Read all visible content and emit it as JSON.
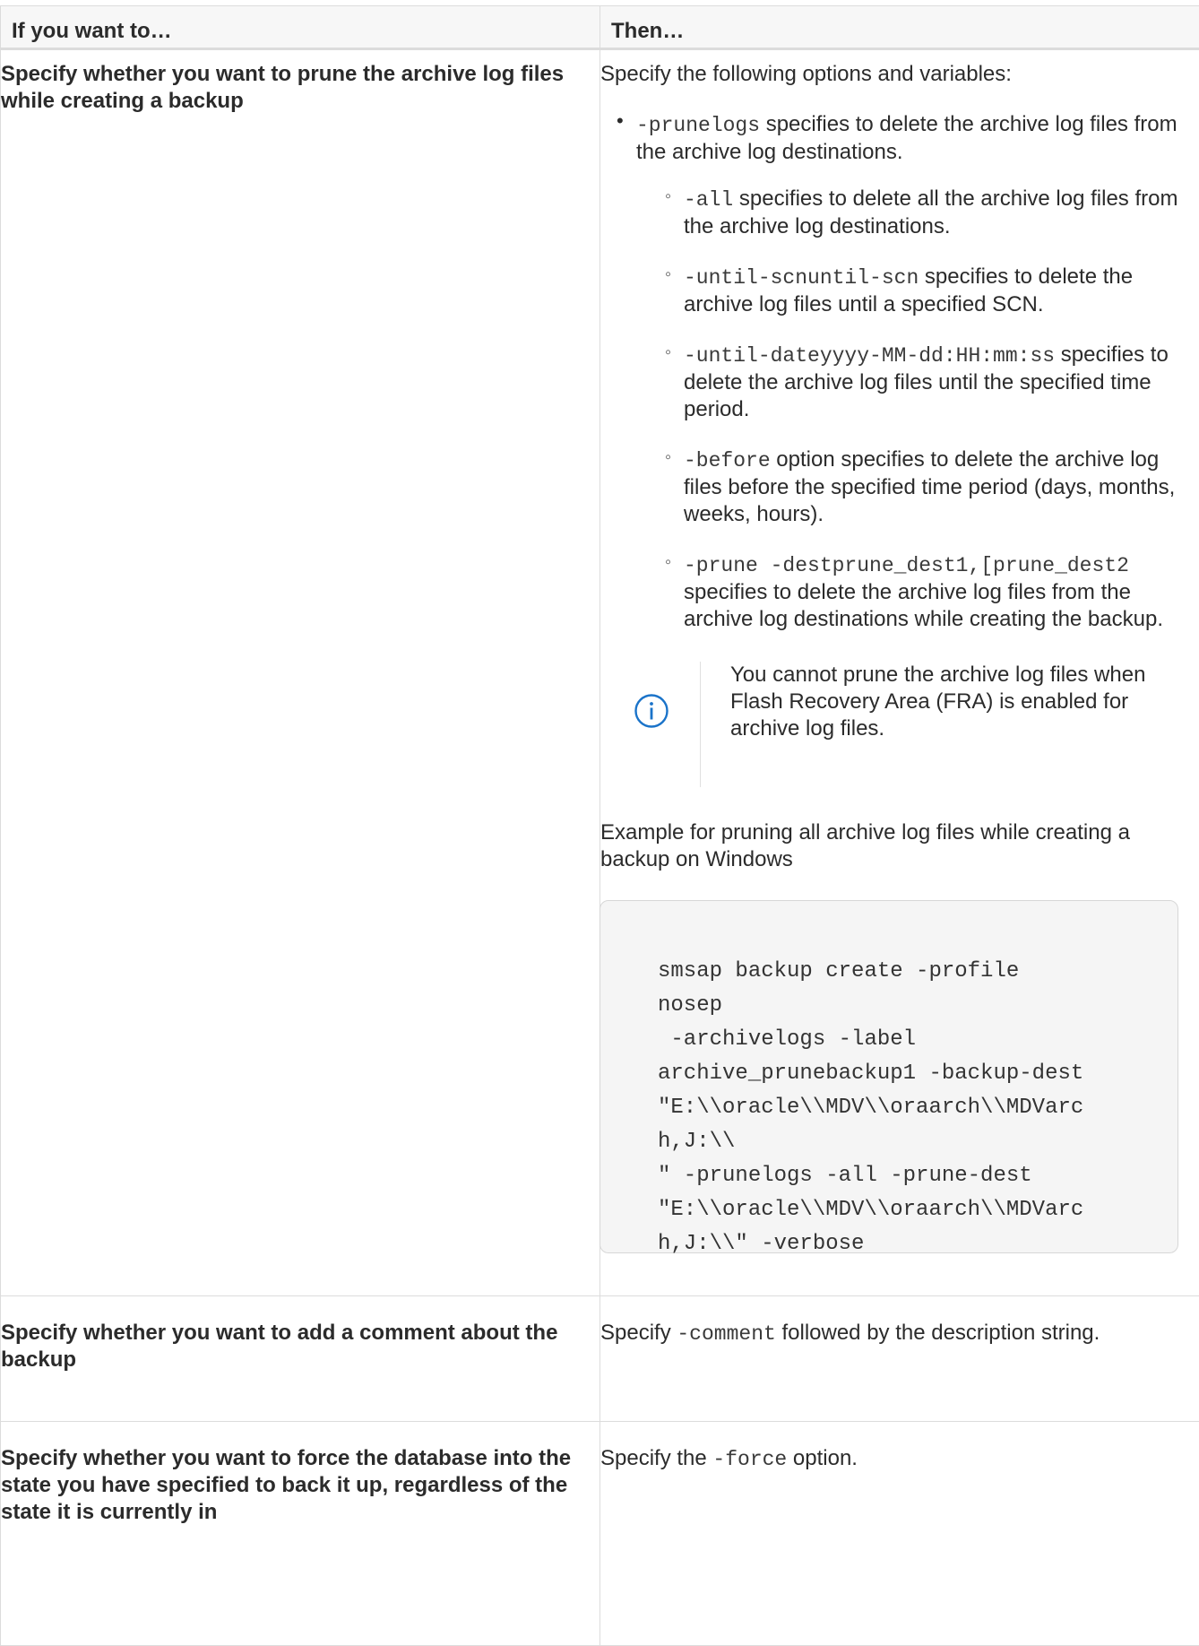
{
  "header": {
    "col1": "If you want to…",
    "col2": "Then…"
  },
  "row1": {
    "want": "Specify whether you want to prune the archive log files while creating a backup",
    "intro": "Specify the following options and variables:",
    "bullet": {
      "code": "-prunelogs",
      "text": " specifies to delete the archive log files from the archive log destinations."
    },
    "subs": [
      {
        "code": "-all",
        "text": " specifies to delete all the archive log files from the archive log destinations."
      },
      {
        "code": "-until-scnuntil-scn",
        "text": " specifies to delete the archive log files until a specified SCN."
      },
      {
        "code": "-until-dateyyyy-MM-dd:HH:mm:ss",
        "text": " specifies to delete the archive log files until the specified time period."
      },
      {
        "code": "-before",
        "text": " option specifies to delete the archive log files before the specified time period (days, months, weeks, hours)."
      },
      {
        "code": "-prune -destprune_dest1,[prune_dest2",
        "text": " specifies to delete the archive log files from the archive log destinations while creating the backup."
      }
    ],
    "note": "You cannot prune the archive log files when Flash Recovery Area (FRA) is enabled for archive log files.",
    "example_label": "Example for pruning all archive log files while creating a backup on Windows",
    "code_lines": [
      "smsap backup create -profile",
      "nosep",
      " -archivelogs -label",
      "archive_prunebackup1 -backup-dest",
      "\"E:\\\\oracle\\\\MDV\\\\oraarch\\\\MDVarc",
      "h,J:\\\\",
      "\" -prunelogs -all -prune-dest",
      "\"E:\\\\oracle\\\\MDV\\\\oraarch\\\\MDVarc",
      "h,J:\\\\\" -verbose"
    ]
  },
  "row2": {
    "want": "Specify whether you want to add a comment about the backup",
    "then_pre": "Specify ",
    "then_code": "-comment",
    "then_post": " followed by the description string."
  },
  "row3": {
    "want": "Specify whether you want to force the database into the state you have specified to back it up, regardless of the state it is currently in",
    "then_pre": "Specify the ",
    "then_code": "-force",
    "then_post": " option."
  },
  "icons": {
    "note": "info-icon",
    "accent": "#1a73c9"
  }
}
